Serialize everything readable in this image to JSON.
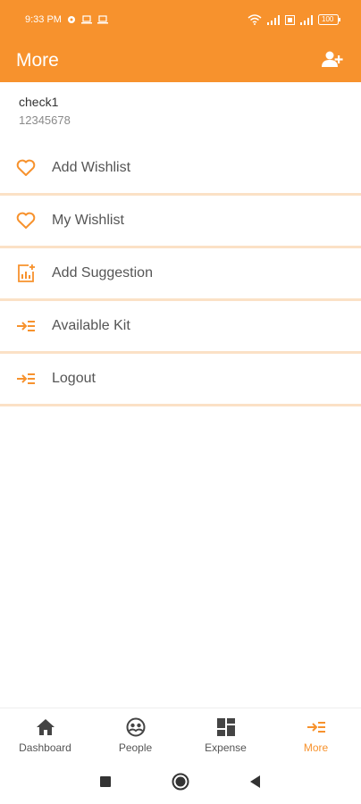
{
  "status_bar": {
    "time": "9:33 PM",
    "battery": "100"
  },
  "app_bar": {
    "title": "More",
    "action_icon": "add-user-icon"
  },
  "profile": {
    "name": "check1",
    "phone": "12345678"
  },
  "menu": [
    {
      "label": "Add Wishlist",
      "icon": "heart-icon"
    },
    {
      "label": "My Wishlist",
      "icon": "heart-icon"
    },
    {
      "label": "Add Suggestion",
      "icon": "suggestion-icon"
    },
    {
      "label": "Available Kit",
      "icon": "arrow-list-icon"
    },
    {
      "label": "Logout",
      "icon": "arrow-list-icon"
    }
  ],
  "bottom_nav": [
    {
      "label": "Dashboard",
      "icon": "home-icon",
      "active": false
    },
    {
      "label": "People",
      "icon": "people-icon",
      "active": false
    },
    {
      "label": "Expense",
      "icon": "grid-icon",
      "active": false
    },
    {
      "label": "More",
      "icon": "arrow-list-icon",
      "active": true
    }
  ],
  "colors": {
    "primary": "#f7922d",
    "divider": "#fbe1c6",
    "text": "#555555",
    "muted": "#8a8a8a"
  }
}
